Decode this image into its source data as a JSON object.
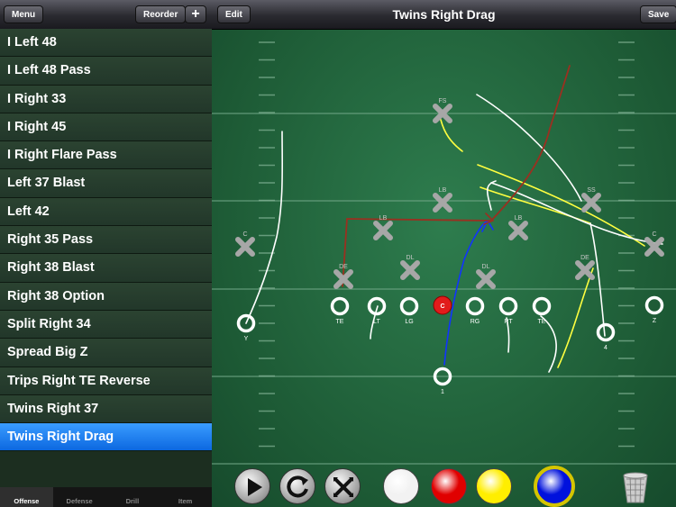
{
  "sidebar": {
    "menu_label": "Menu",
    "reorder_label": "Reorder",
    "add_label": "+",
    "plays": [
      "I Left 48",
      "I Left 48 Pass",
      "I Right 33",
      "I Right 45",
      "I Right Flare Pass",
      "Left 37 Blast",
      "Left 42",
      "Right 35 Pass",
      "Right 38 Blast",
      "Right 38 Option",
      "Split Right 34",
      "Spread Big Z",
      "Trips Right TE Reverse",
      "Twins Right 37",
      "Twins Right Drag"
    ],
    "selected_index": 14,
    "tabs": [
      "Offense",
      "Defense",
      "Drill",
      "Item"
    ],
    "active_tab": 0
  },
  "header": {
    "edit_label": "Edit",
    "title": "Twins Right Drag",
    "save_label": "Save"
  },
  "field": {
    "defense": [
      {
        "label": "FS"
      },
      {
        "label": "LB"
      },
      {
        "label": "SS"
      },
      {
        "label": "C"
      },
      {
        "label": "LB"
      },
      {
        "label": "LB"
      },
      {
        "label": "C"
      },
      {
        "label": "DE"
      },
      {
        "label": "DL"
      },
      {
        "label": "DL"
      },
      {
        "label": "DE"
      }
    ],
    "offense": [
      {
        "label": "Y"
      },
      {
        "label": "TE"
      },
      {
        "label": "LT"
      },
      {
        "label": "LG"
      },
      {
        "label": "C"
      },
      {
        "label": "RG"
      },
      {
        "label": "RT"
      },
      {
        "label": "TE"
      },
      {
        "label": "Z"
      },
      {
        "label": "4"
      },
      {
        "label": "1"
      }
    ]
  },
  "toolbar": {
    "tools": [
      "play-icon",
      "reset-icon",
      "shuffle-icon"
    ],
    "colors": [
      "#f2f2f2",
      "#e00000",
      "#ffee00",
      "#0011dd"
    ],
    "selected_color_index": 3,
    "trash_icon": "trash-icon"
  }
}
